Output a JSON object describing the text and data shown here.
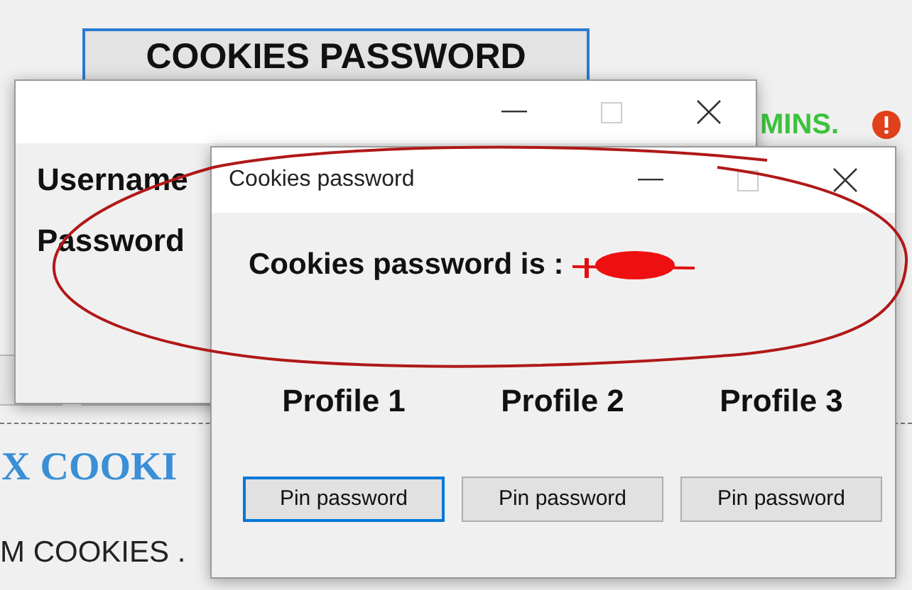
{
  "page": {
    "header_button": "COOKIES PASSWORD",
    "notice_right": "MINS.",
    "heading": "X COOKI",
    "footer_text": "M COOKIES ."
  },
  "back_window": {
    "fields": [
      {
        "label": "Username"
      },
      {
        "label": "Password"
      }
    ]
  },
  "dialog": {
    "title": "Cookies password",
    "message": "Cookies password is :",
    "redacted": true,
    "profiles": [
      {
        "label": "Profile 1",
        "button": "Pin password",
        "focused": true
      },
      {
        "label": "Profile 2",
        "button": "Pin password",
        "focused": false
      },
      {
        "label": "Profile 3",
        "button": "Pin password",
        "focused": false
      }
    ]
  },
  "annotation": {
    "circled": true
  }
}
